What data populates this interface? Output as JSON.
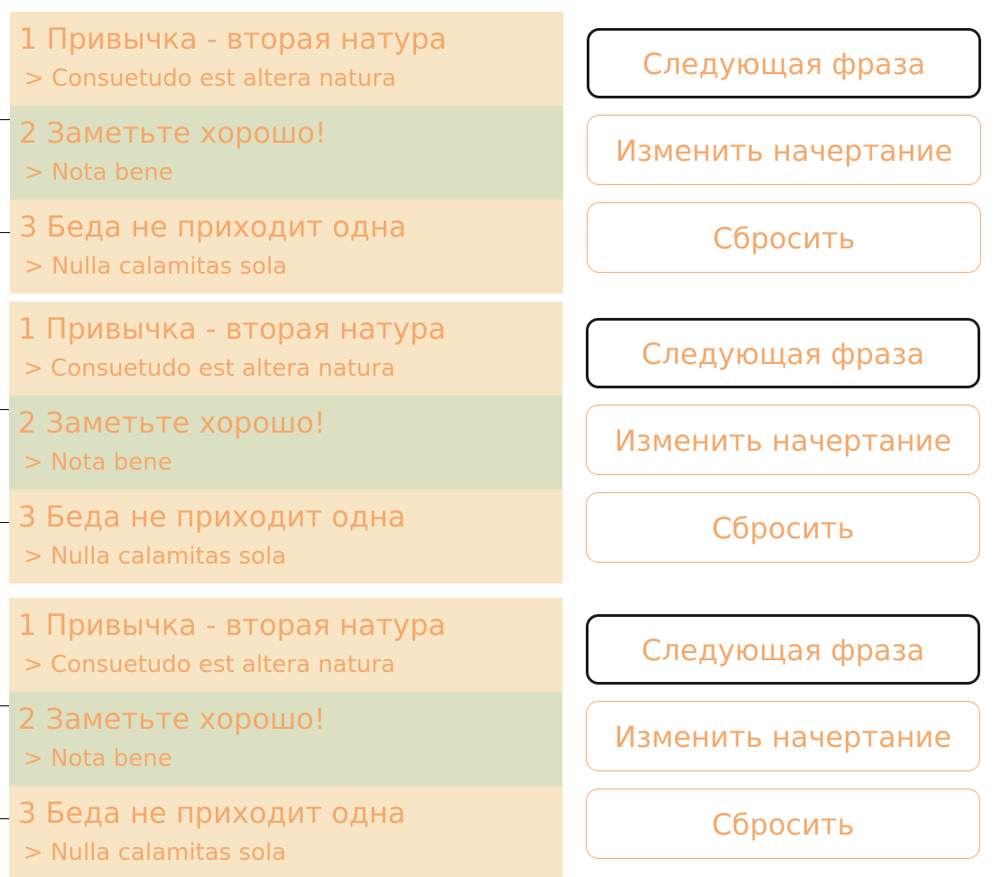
{
  "panels": [
    {
      "items": [
        {
          "phrase": "1 Привычка - вторая натура",
          "latin": "> Consuetudo est altera natura"
        },
        {
          "phrase": "2 Заметьте хорошо!",
          "latin": "> Nota bene"
        },
        {
          "phrase": "3 Беда не приходит одна",
          "latin": "> Nulla calamitas sola"
        }
      ],
      "buttons": {
        "next": "Следующая фраза",
        "style": "Изменить начертание",
        "reset": "Сбросить"
      }
    },
    {
      "items": [
        {
          "phrase": "1 Привычка - вторая натура",
          "latin": "> Consuetudo est altera natura"
        },
        {
          "phrase": "2 Заметьте хорошо!",
          "latin": "> Nota bene"
        },
        {
          "phrase": "3 Беда не приходит одна",
          "latin": "> Nulla calamitas sola"
        }
      ],
      "buttons": {
        "next": "Следующая фраза",
        "style": "Изменить начертание",
        "reset": "Сбросить"
      }
    },
    {
      "items": [
        {
          "phrase": "1 Привычка - вторая натура",
          "latin": "> Consuetudo est altera natura"
        },
        {
          "phrase": "2 Заметьте хорошо!",
          "latin": "> Nota bene"
        },
        {
          "phrase": "3 Беда не приходит одна",
          "latin": "> Nulla calamitas sola"
        }
      ],
      "buttons": {
        "next": "Следующая фраза",
        "style": "Изменить начертание",
        "reset": "Сбросить"
      }
    }
  ],
  "colors": {
    "text": "#f5a86b",
    "row_odd": "#f7e5c5",
    "row_even": "#dbe0c2",
    "primary_border": "#1a1a1a"
  }
}
